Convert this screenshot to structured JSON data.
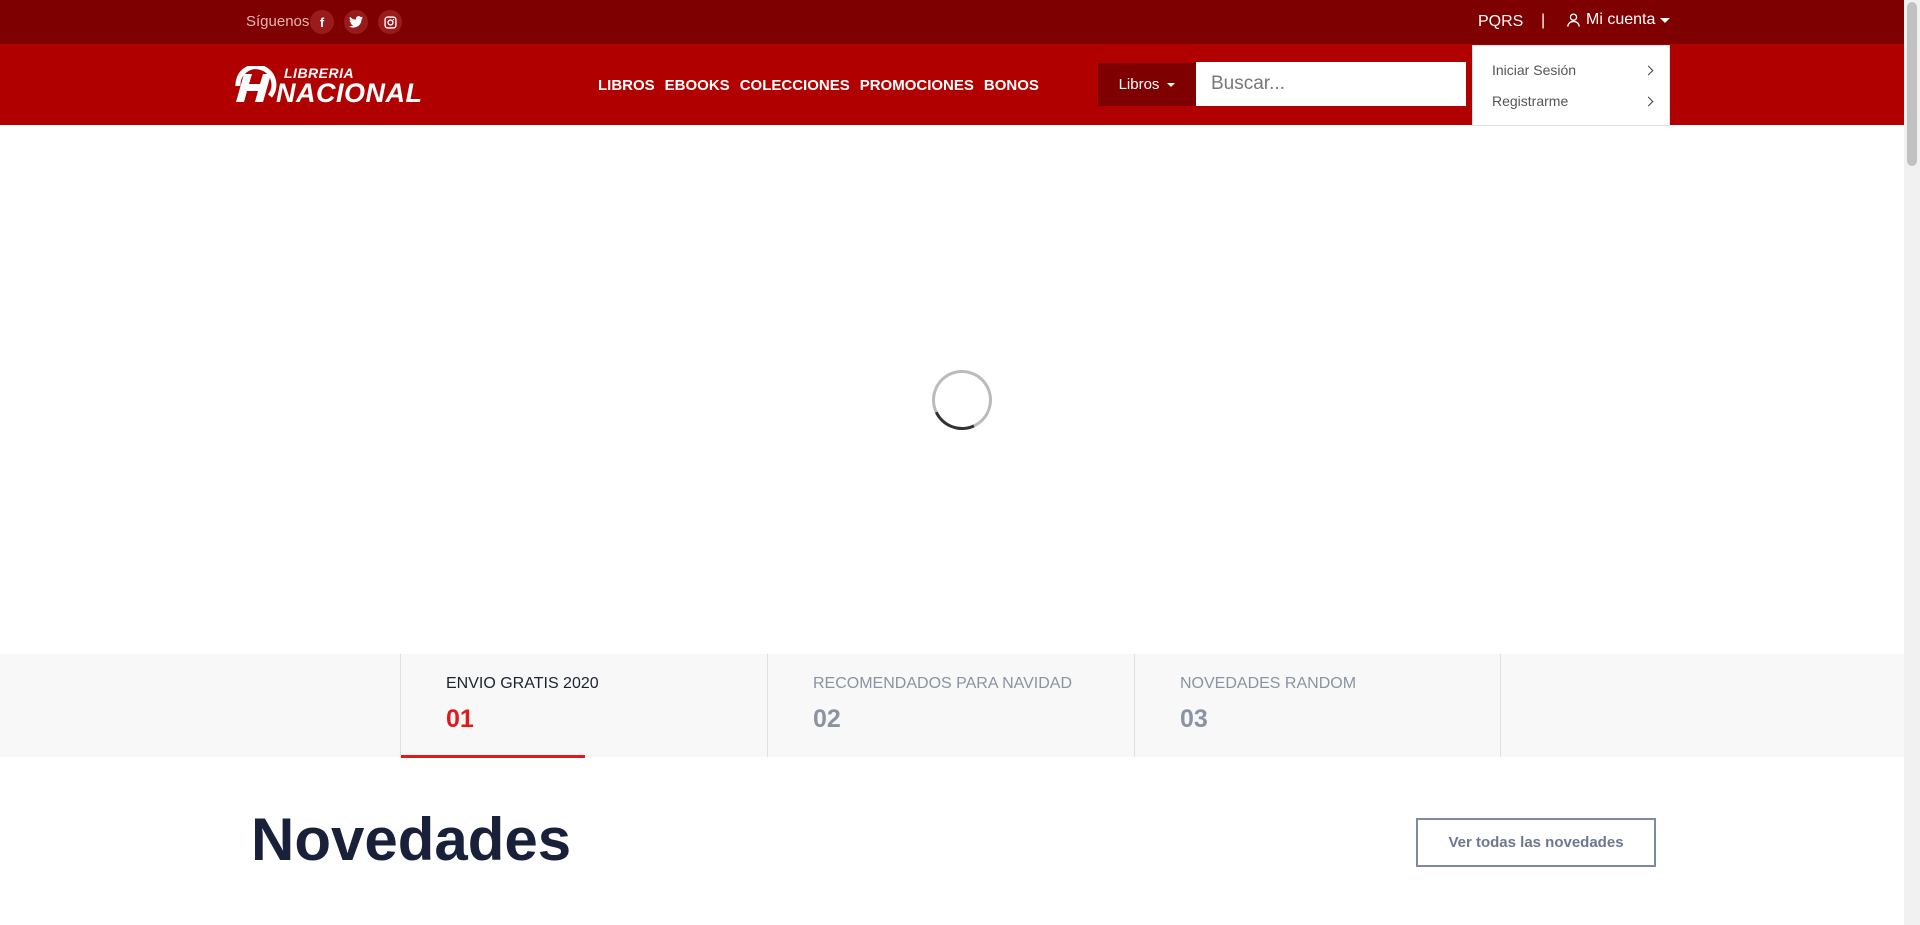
{
  "topbar": {
    "social_label": "Síguenos",
    "social": [
      {
        "name": "facebook-icon",
        "glyph": "f"
      },
      {
        "name": "twitter-icon",
        "glyph": "t"
      },
      {
        "name": "instagram-icon",
        "glyph": "◎"
      }
    ],
    "pqrs_label": "PQRS",
    "separator": "|",
    "account_label": "Mi cuenta"
  },
  "header": {
    "logo_small": "LIBRERIA",
    "logo_big": "NACIONAL",
    "nav": [
      "LIBROS",
      "EBOOKS",
      "COLECCIONES",
      "PROMOCIONES",
      "BONOS"
    ],
    "search_category": "Libros",
    "search_placeholder": "Buscar..."
  },
  "account_menu": {
    "items": [
      "Iniciar Sesión",
      "Registrarme"
    ]
  },
  "slider_tabs": [
    {
      "label": "ENVIO GRATIS 2020",
      "number": "01",
      "active": true
    },
    {
      "label": "RECOMENDADOS PARA NAVIDAD",
      "number": "02",
      "active": false
    },
    {
      "label": "NOVEDADES RANDOM",
      "number": "03",
      "active": false
    }
  ],
  "novedades": {
    "title": "Novedades",
    "view_all_label": "Ver todas las novedades"
  },
  "colors": {
    "topbar": "#7e0000",
    "navbar": "#b10000",
    "accent": "#e0191d",
    "heading": "#18203a"
  }
}
